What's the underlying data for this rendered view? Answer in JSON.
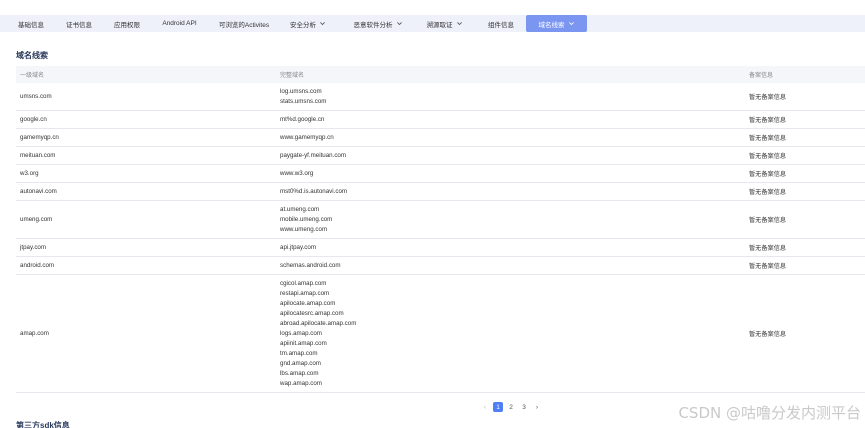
{
  "tabs": [
    {
      "label": "基础信息",
      "dropdown": false,
      "active": false
    },
    {
      "label": "证书信息",
      "dropdown": false,
      "active": false
    },
    {
      "label": "应用权限",
      "dropdown": false,
      "active": false
    },
    {
      "label": "Android API",
      "dropdown": false,
      "active": false
    },
    {
      "label": "可浏览的Activites",
      "dropdown": false,
      "active": false
    },
    {
      "label": "安全分析",
      "dropdown": true,
      "active": false
    },
    {
      "label": "恶意软件分析",
      "dropdown": true,
      "active": false
    },
    {
      "label": "溯源取证",
      "dropdown": true,
      "active": false
    },
    {
      "label": "组件信息",
      "dropdown": false,
      "active": false
    },
    {
      "label": "域名线索",
      "dropdown": true,
      "active": true
    }
  ],
  "section_title": "域名线索",
  "table": {
    "headers": [
      "一级域名",
      "完整域名",
      "备案信息"
    ],
    "rows": [
      {
        "domain": "umsns.com",
        "full": [
          "log.umsns.com",
          "stats.umsns.com"
        ],
        "record": "暂无备案信息"
      },
      {
        "domain": "google.cn",
        "full": [
          "mt%d.google.cn"
        ],
        "record": "暂无备案信息"
      },
      {
        "domain": "gamemyqp.cn",
        "full": [
          "www.gamemyqp.cn"
        ],
        "record": "暂无备案信息"
      },
      {
        "domain": "meituan.com",
        "full": [
          "paygate-yf.meituan.com"
        ],
        "record": "暂无备案信息"
      },
      {
        "domain": "w3.org",
        "full": [
          "www.w3.org"
        ],
        "record": "暂无备案信息"
      },
      {
        "domain": "autonavi.com",
        "full": [
          "mst0%d.is.autonavi.com"
        ],
        "record": "暂无备案信息"
      },
      {
        "domain": "umeng.com",
        "full": [
          "at.umeng.com",
          "mobile.umeng.com",
          "www.umeng.com"
        ],
        "record": "暂无备案信息"
      },
      {
        "domain": "jtpay.com",
        "full": [
          "api.jtpay.com"
        ],
        "record": "暂无备案信息"
      },
      {
        "domain": "android.com",
        "full": [
          "schemas.android.com"
        ],
        "record": "暂无备案信息"
      },
      {
        "domain": "amap.com",
        "full": [
          "cgicol.amap.com",
          "restapi.amap.com",
          "apilocate.amap.com",
          "apilocatesrc.amap.com",
          "abroad.apilocate.amap.com",
          "logs.amap.com",
          "apiinit.amap.com",
          "tm.amap.com",
          "gnd.amap.com",
          "lbs.amap.com",
          "wap.amap.com"
        ],
        "record": "暂无备案信息"
      }
    ]
  },
  "pagination": {
    "prev": "‹",
    "pages": [
      "1",
      "2",
      "3"
    ],
    "current": "1",
    "next": "›"
  },
  "next_section_title": "第三方sdk信息",
  "watermark": "CSDN @咕噜分发内测平台"
}
